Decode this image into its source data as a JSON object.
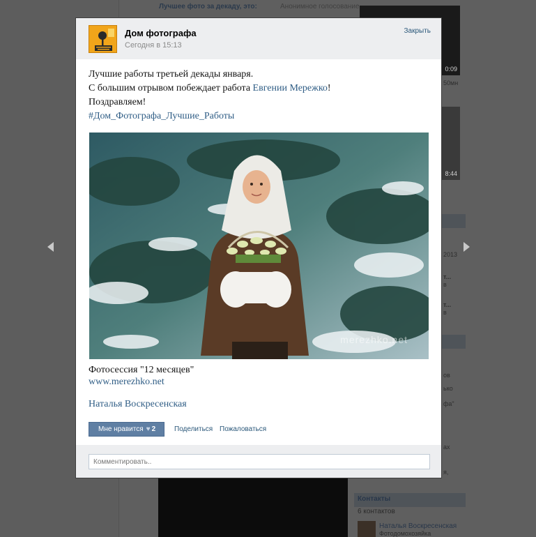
{
  "background": {
    "feed_title": "Лучшее фото за декаду, это:",
    "feed_subtitle": "Анонимное голосование",
    "video_time_1": "0:09",
    "video_time_2": "8:44",
    "right_fragments": [
      "50мн",
      "2013",
      "т...",
      "в",
      "т...",
      "в",
      "в",
      "ов",
      "ько",
      "фа\"",
      "в",
      "в",
      "ах",
      "в",
      "я,"
    ],
    "contacts_title": "Контакты",
    "contacts_count": "6 контактов",
    "contact_name": "Наталья Воскресенская",
    "contact_role": "Фотодомохозяйка"
  },
  "modal": {
    "page_title": "Дом фотографа",
    "post_time": "Сегодня в 15:13",
    "close_label": "Закрыть",
    "text": {
      "line1": "Лучшие работы третьей декады января.",
      "line2_before": "С большим отрывом побеждает работа ",
      "line2_link": "Евгении Мережко",
      "line2_after": "!",
      "line3": "Поздравляем!",
      "hashtag": "#Дом_Фотографа_Лучшие_Работы"
    },
    "photo_watermark": "merezhko.net",
    "caption": "Фотосессия \"12 месяцев\"",
    "caption_url": "www.merezhko.net",
    "author": "Наталья Воскресенская",
    "like_label": "Мне нравится",
    "like_count": "2",
    "share_label": "Поделиться",
    "report_label": "Пожаловаться",
    "comment_placeholder": "Комментировать.."
  },
  "icons": {
    "nav_prev": "chevron-left-icon",
    "nav_next": "chevron-right-icon",
    "like": "heart-icon"
  }
}
